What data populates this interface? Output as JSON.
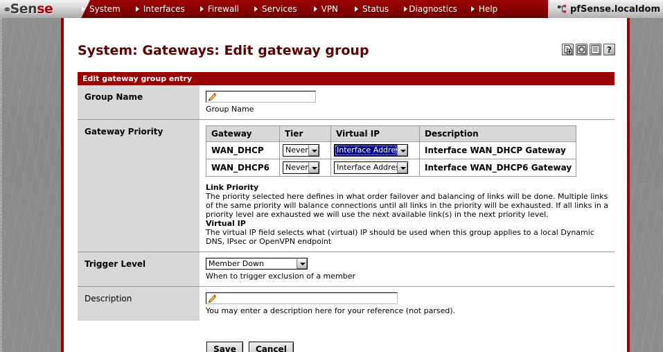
{
  "brand": {
    "logo_pf": "pf",
    "logo_sen": "Sen",
    "logo_se": "se"
  },
  "topnav": {
    "items": [
      {
        "label": "System"
      },
      {
        "label": "Interfaces"
      },
      {
        "label": "Firewall"
      },
      {
        "label": "Services"
      },
      {
        "label": "VPN"
      },
      {
        "label": "Status"
      },
      {
        "label": "Diagnostics"
      },
      {
        "label": "Help"
      }
    ],
    "host_tab": {
      "icon": "network-node-icon",
      "label": "pfSense.localdom"
    }
  },
  "header": {
    "title": "System: Gateways: Edit gateway group",
    "icons": [
      {
        "name": "add-new-icon"
      },
      {
        "name": "save-disk-icon"
      },
      {
        "name": "list-log-icon"
      },
      {
        "name": "help-question-icon"
      }
    ]
  },
  "section": {
    "title": "Edit gateway group entry"
  },
  "form": {
    "group_name": {
      "label": "Group Name",
      "value": "",
      "placeholder": "",
      "help": "Group Name"
    },
    "gateway_priority": {
      "label": "Gateway Priority",
      "table": {
        "columns": [
          "Gateway",
          "Tier",
          "Virtual IP",
          "Description"
        ],
        "rows": [
          {
            "gateway": "WAN_DHCP",
            "tier": "Never",
            "virtual_ip": "Interface Address",
            "virtual_ip_focused": true,
            "description": "Interface WAN_DHCP Gateway"
          },
          {
            "gateway": "WAN_DHCP6",
            "tier": "Never",
            "virtual_ip": "Interface Address",
            "virtual_ip_focused": false,
            "description": "Interface WAN_DHCP6 Gateway"
          }
        ]
      },
      "notes": {
        "link_priority_title": "Link Priority",
        "link_priority_body": "The priority selected here defines in what order failover and balancing of links will be done. Multiple links of the same priority will balance connections until all links in the priority will be exhausted. If all links in a priority level are exhausted we will use the next available link(s) in the next priority level.",
        "virtual_ip_title": "Virtual IP",
        "virtual_ip_body": "The virtual IP field selects what (virtual) IP should be used when this group applies to a local Dynamic DNS, IPsec or OpenVPN endpoint"
      }
    },
    "trigger_level": {
      "label": "Trigger Level",
      "value": "Member Down",
      "help": "When to trigger exclusion of a member"
    },
    "description": {
      "label": "Description",
      "value": "",
      "placeholder": "",
      "help": "You may enter a description here for your reference (not parsed)."
    }
  },
  "actions": {
    "save_label": "Save",
    "cancel_label": "Cancel"
  },
  "colors": {
    "brand_red": "#990000",
    "title_maroon": "#5b0000",
    "label_gray": "#d8d8d8",
    "select_focus_navy": "#000080",
    "background_gray": "#8a8a8a"
  }
}
